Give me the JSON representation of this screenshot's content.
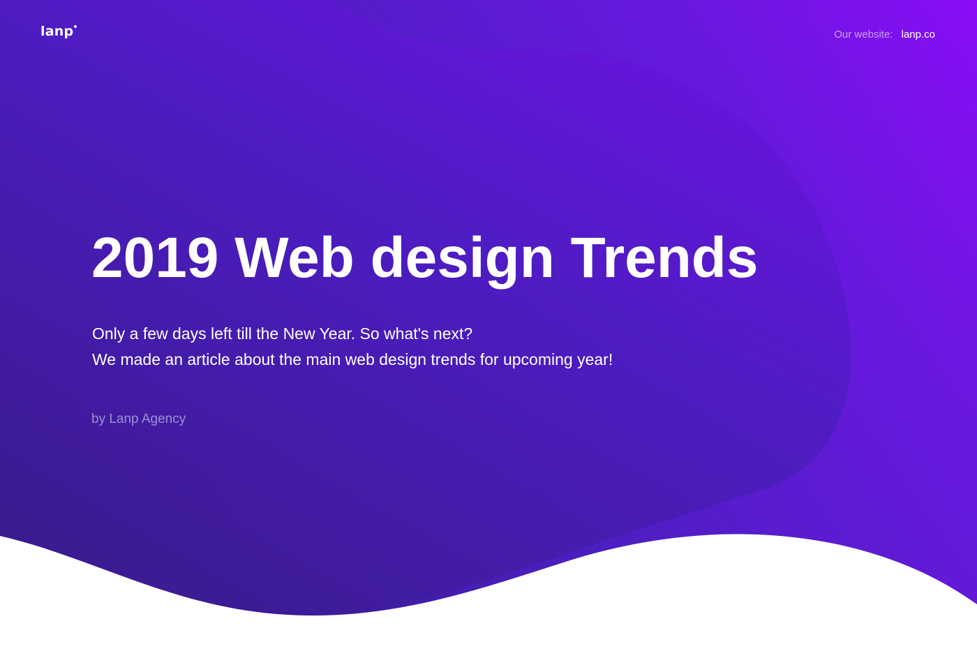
{
  "header": {
    "logo": "lanp",
    "website_label": "Our website:",
    "website_link": "lanp.co"
  },
  "hero": {
    "title": "2019 Web design Trends",
    "subtitle_line1": "Only a few days left till the New Year. So what's next?",
    "subtitle_line2": "We made an article about the main web design trends for upcoming year!",
    "byline": "by Lanp Agency"
  },
  "colors": {
    "gradient_dark": "#371a85",
    "gradient_mid": "#4a1fbe",
    "gradient_bright": "#8a0cf5",
    "blob_top": "#5e15d6",
    "blob_bottom": "#43209f",
    "wave": "#ffffff"
  }
}
